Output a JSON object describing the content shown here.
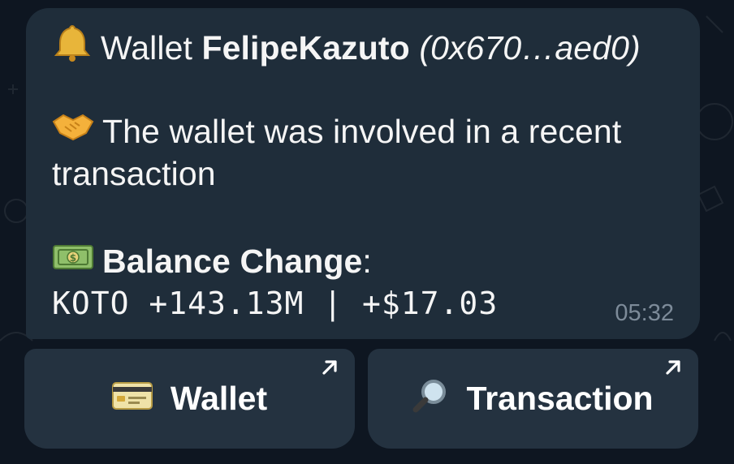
{
  "message": {
    "line1": {
      "icon": "bell-icon",
      "prefix": "Wallet ",
      "name": "FelipeKazuto",
      "space": " ",
      "address": "(0x670…aed0)"
    },
    "line2": {
      "icon": "handshake-icon",
      "text": "The wallet was involved in a recent"
    },
    "line3": {
      "text": "transaction"
    },
    "line4": {
      "icon": "dollar-banknote-icon",
      "label": "Balance Change",
      "colon": ":"
    },
    "line5": {
      "text": "KOTO +143.13M | +$17.03"
    },
    "time": "05:32"
  },
  "buttons": [
    {
      "icon": "credit-card-icon",
      "label": "Wallet",
      "corner_icon": "external-arrow-icon"
    },
    {
      "icon": "magnifying-glass-icon",
      "label": "Transaction",
      "corner_icon": "external-arrow-icon"
    }
  ],
  "colors": {
    "background": "#0e1621",
    "bubble": "#1f2d3a",
    "button": "#243240",
    "text": "#f5f5f5",
    "time": "#7d8b99"
  }
}
